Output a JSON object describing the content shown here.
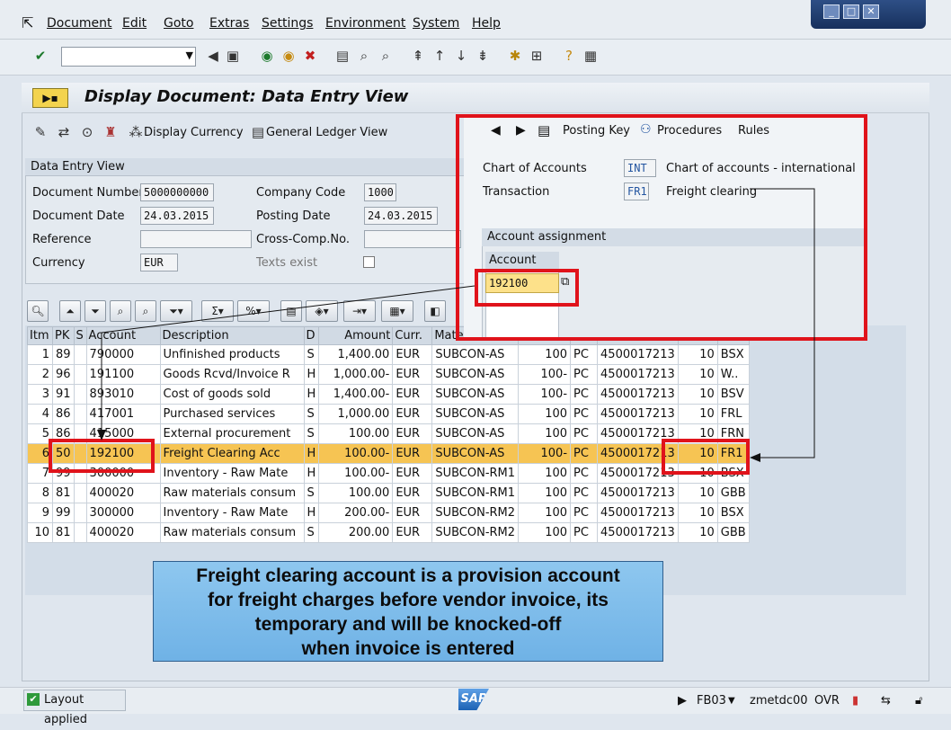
{
  "menu": {
    "items": [
      "Document",
      "Edit",
      "Goto",
      "Extras",
      "Settings",
      "Environment",
      "System",
      "Help"
    ]
  },
  "window": {
    "title": "Display Document: Data Entry View"
  },
  "app_toolbar": {
    "display_currency": "Display Currency",
    "general_ledger_view": "General Ledger View"
  },
  "data_entry_view": {
    "header": "Data Entry View",
    "document_number_label": "Document Number",
    "document_number": "5000000000",
    "company_code_label": "Company Code",
    "company_code": "1000",
    "document_date_label": "Document Date",
    "document_date": "24.03.2015",
    "posting_date_label": "Posting Date",
    "posting_date": "24.03.2015",
    "reference_label": "Reference",
    "cross_comp_label": "Cross-Comp.No.",
    "currency_label": "Currency",
    "currency": "EUR",
    "texts_exist_label": "Texts exist"
  },
  "popup": {
    "posting_key": "Posting Key",
    "procedures": "Procedures",
    "rules": "Rules",
    "chart_of_accounts_label": "Chart of Accounts",
    "chart_of_accounts": "INT",
    "chart_of_accounts_desc": "Chart of accounts - international",
    "transaction_label": "Transaction",
    "transaction": "FR1",
    "transaction_desc": "Freight clearing",
    "account_assignment_header": "Account assignment",
    "account_col": "Account",
    "account_value": "192100"
  },
  "table": {
    "columns": [
      "Itm",
      "PK",
      "S",
      "Account",
      "Description",
      "D",
      "Amount",
      "Curr.",
      "Mate",
      "",
      "",
      "",
      "",
      ""
    ],
    "rows": [
      [
        "1",
        "89",
        "",
        "790000",
        "Unfinished products",
        "S",
        "1,400.00",
        "EUR",
        "SUBCON-AS",
        "100",
        "PC",
        "4500017213",
        "10",
        "BSX"
      ],
      [
        "2",
        "96",
        "",
        "191100",
        "Goods Rcvd/Invoice R",
        "H",
        "1,000.00-",
        "EUR",
        "SUBCON-AS",
        "100-",
        "PC",
        "4500017213",
        "10",
        "W.."
      ],
      [
        "3",
        "91",
        "",
        "893010",
        "Cost of goods sold",
        "H",
        "1,400.00-",
        "EUR",
        "SUBCON-AS",
        "100-",
        "PC",
        "4500017213",
        "10",
        "BSV"
      ],
      [
        "4",
        "86",
        "",
        "417001",
        "Purchased services",
        "S",
        "1,000.00",
        "EUR",
        "SUBCON-AS",
        "100",
        "PC",
        "4500017213",
        "10",
        "FRL"
      ],
      [
        "5",
        "86",
        "",
        "415000",
        "External procurement",
        "S",
        "100.00",
        "EUR",
        "SUBCON-AS",
        "100",
        "PC",
        "4500017213",
        "10",
        "FRN"
      ],
      [
        "6",
        "50",
        "",
        "192100",
        "Freight Clearing Acc",
        "H",
        "100.00-",
        "EUR",
        "SUBCON-AS",
        "100-",
        "PC",
        "4500017213",
        "10",
        "FR1"
      ],
      [
        "7",
        "99",
        "",
        "300000",
        "Inventory - Raw Mate",
        "H",
        "100.00-",
        "EUR",
        "SUBCON-RM1",
        "100",
        "PC",
        "4500017213",
        "10",
        "BSX"
      ],
      [
        "8",
        "81",
        "",
        "400020",
        "Raw materials consum",
        "S",
        "100.00",
        "EUR",
        "SUBCON-RM1",
        "100",
        "PC",
        "4500017213",
        "10",
        "GBB"
      ],
      [
        "9",
        "99",
        "",
        "300000",
        "Inventory - Raw Mate",
        "H",
        "200.00-",
        "EUR",
        "SUBCON-RM2",
        "100",
        "PC",
        "4500017213",
        "10",
        "BSX"
      ],
      [
        "10",
        "81",
        "",
        "400020",
        "Raw materials consum",
        "S",
        "200.00",
        "EUR",
        "SUBCON-RM2",
        "100",
        "PC",
        "4500017213",
        "10",
        "GBB"
      ]
    ]
  },
  "callout": {
    "line1": "Freight clearing account is a provision account",
    "line2": "for freight charges before vendor invoice, its",
    "line3": "temporary and will be knocked-off",
    "line4": "when invoice is entered"
  },
  "statusbar": {
    "message": "Layout applied",
    "logo": "SAP",
    "tcode": "FB03",
    "server": "zmetdc00",
    "mode": "OVR"
  },
  "colors": {
    "highlight_row": "#f6c453",
    "annotation_red": "#e0131b",
    "callout_blue": "#7fbcea"
  }
}
